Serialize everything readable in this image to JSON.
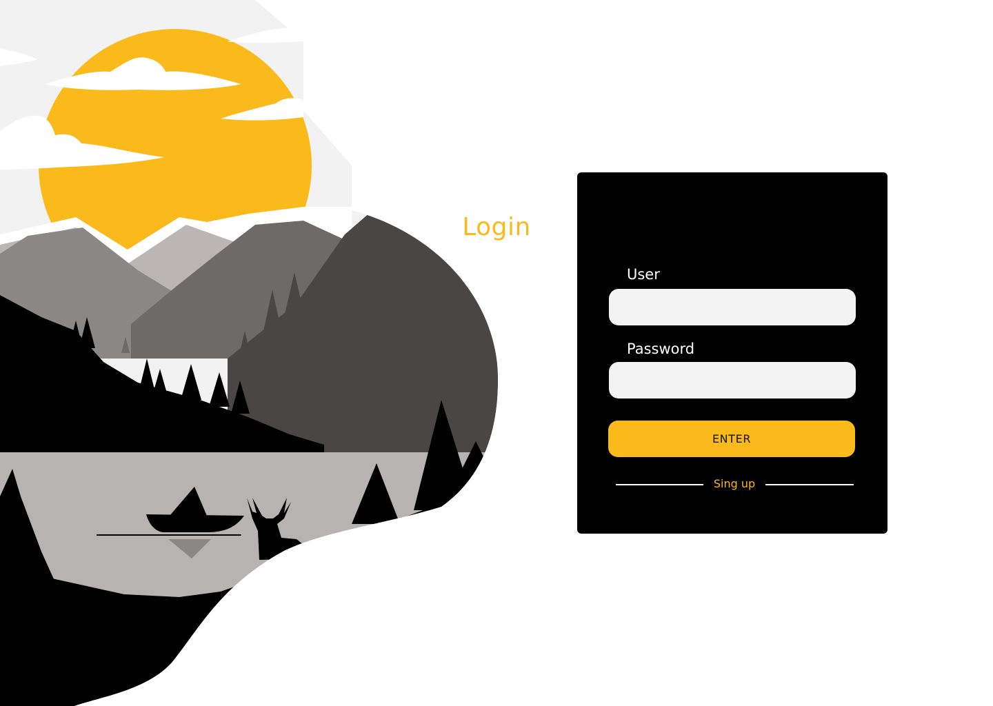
{
  "colors": {
    "accent": "#FBBA1B",
    "card_background": "#000000",
    "input_background": "#F3F3F3",
    "page_background": "#FFFFFF"
  },
  "illustration": {
    "icon": "mountain-lake-landscape-illustration"
  },
  "login": {
    "title": "Login",
    "user_label": "User",
    "user_value": "",
    "password_label": "Password",
    "password_value": "",
    "enter_label": "ENTER",
    "signup_label": "Sing up"
  }
}
